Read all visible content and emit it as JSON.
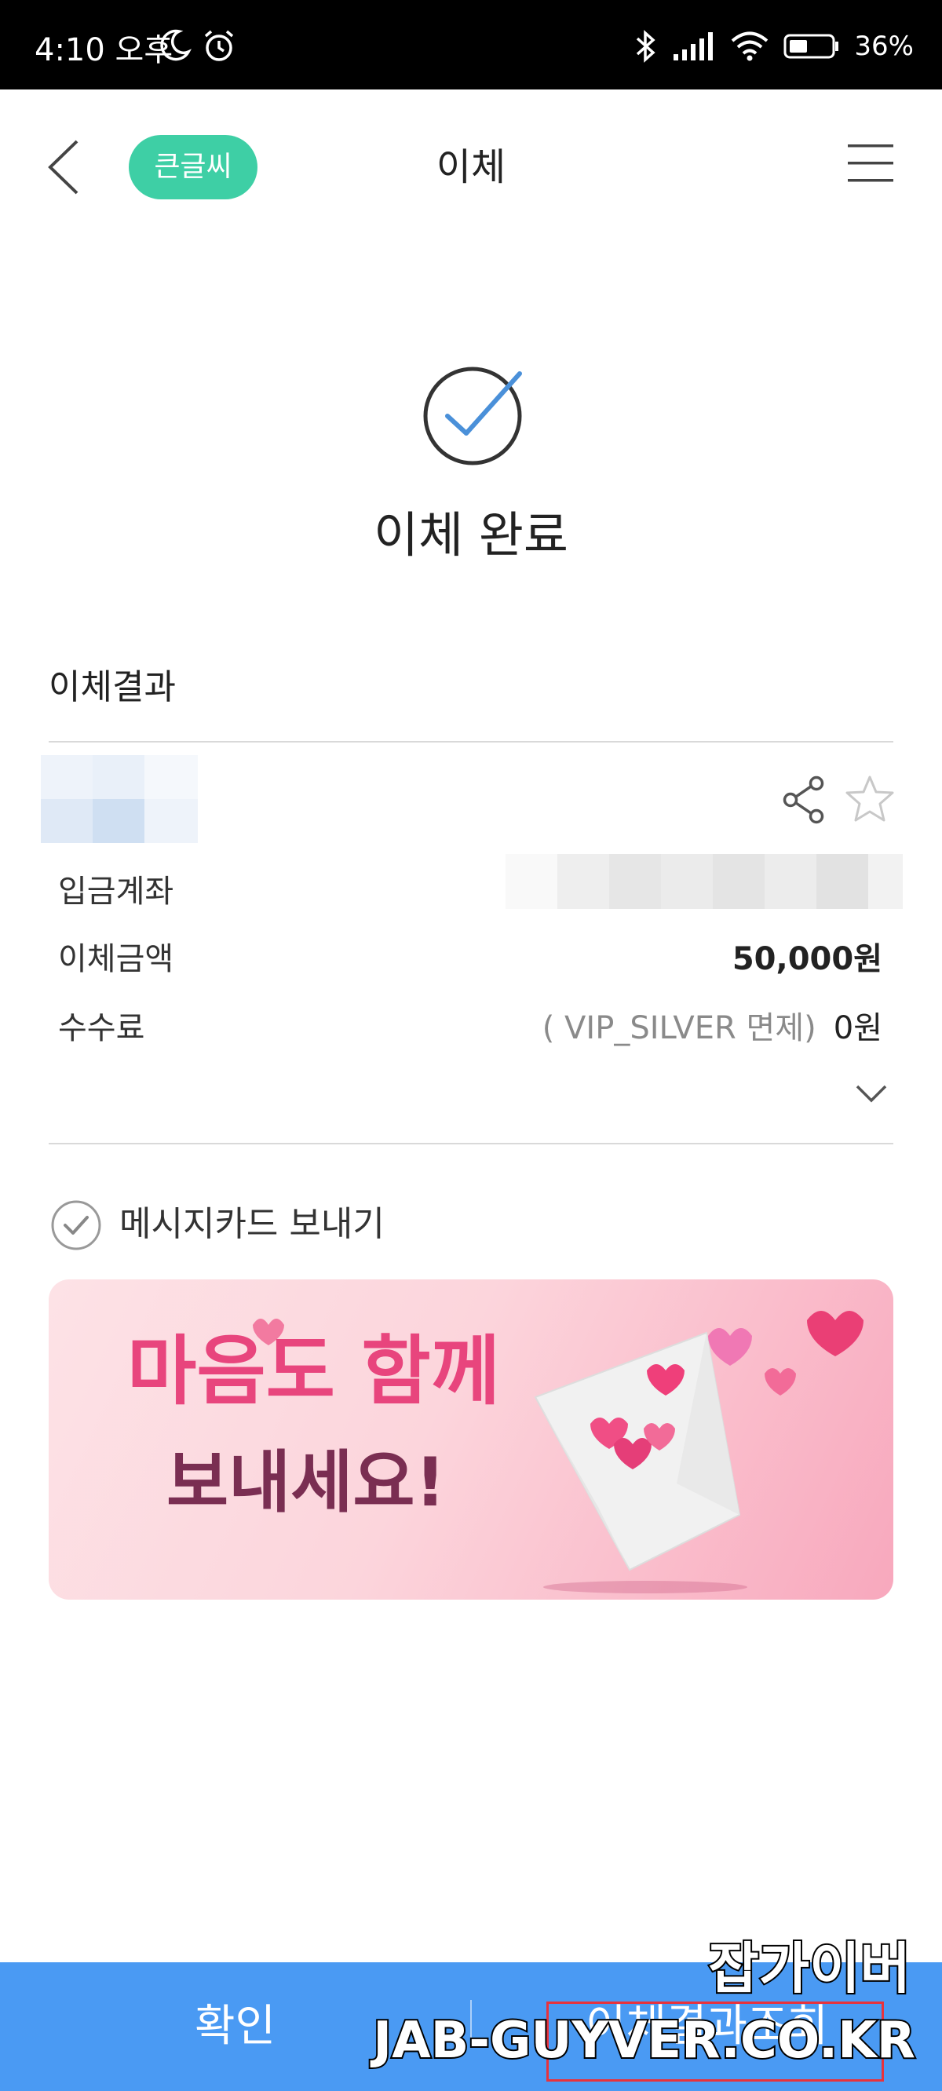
{
  "status_bar": {
    "time": "4:10 오후",
    "battery": "36%",
    "icons": [
      "moon-icon",
      "alarm-icon",
      "bluetooth-icon",
      "signal-icon",
      "wifi-icon",
      "battery-icon"
    ]
  },
  "header": {
    "back_icon": "chevron-left-icon",
    "big_font_label": "큰글씨",
    "title": "이체",
    "menu_icon": "hamburger-menu-icon"
  },
  "result": {
    "icon": "check-circle-icon",
    "title": "이체 완료",
    "section_title": "이체결과",
    "rows": [
      {
        "label": "입금계좌",
        "value": ""
      },
      {
        "label": "이체금액",
        "value": "50,000원"
      },
      {
        "label": "수수료",
        "note": "( VIP_SILVER 면제)",
        "value": "0원"
      }
    ],
    "icons": [
      "share-icon",
      "star-icon",
      "chevron-down-icon"
    ]
  },
  "message_card": {
    "label": "메시지카드 보내기",
    "banner_text_line1": "마음도 함께",
    "banner_text_line2": "보내세요!"
  },
  "bottom": {
    "confirm_label": "확인",
    "history_label": "이체결과조회"
  },
  "watermark": {
    "line1": "잡가이버",
    "line2": "JAB-GUYVER.CO.KR"
  },
  "colors": {
    "accent_green": "#3ecfa5",
    "check_blue": "#4a90d9",
    "bottom_bar_blue": "#4a9af3",
    "banner_pink": "#f8a8bd",
    "banner_text": "#7a2e52"
  }
}
